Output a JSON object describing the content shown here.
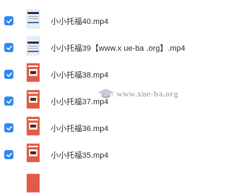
{
  "files": [
    {
      "name": "小小托福40.mp4",
      "selected": true,
      "thumbnail": "screen-icon"
    },
    {
      "name": "小小托福39【www.x ue-ba .org】.mp4",
      "selected": true,
      "thumbnail": "screen-icon"
    },
    {
      "name": "小小托福38.mp4",
      "selected": true,
      "thumbnail": "book-cover-icon"
    },
    {
      "name": "小小托福37.mp4",
      "selected": true,
      "thumbnail": "book-cover-icon"
    },
    {
      "name": "小小托福36.mp4",
      "selected": true,
      "thumbnail": "book-cover-icon"
    },
    {
      "name": "小小托福35.mp4",
      "selected": true,
      "thumbnail": "book-cover-icon"
    }
  ],
  "watermark": {
    "text": "www.xue-ba.org"
  },
  "colors": {
    "checkbox": "#2f88f0",
    "text": "#2a2a2a",
    "watermark": "#a9b3bd"
  }
}
